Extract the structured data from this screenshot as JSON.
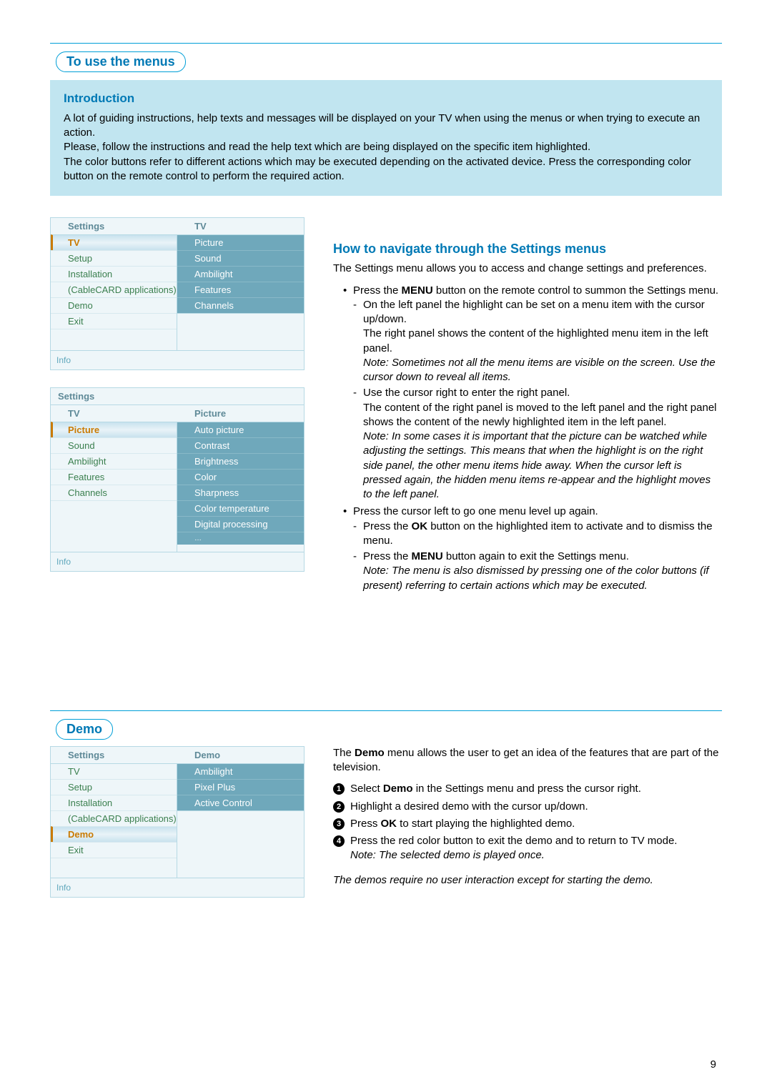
{
  "pageNumber": "9",
  "section1": {
    "title": "To use the menus",
    "intro": {
      "heading": "Introduction",
      "p1": "A lot of guiding instructions, help texts and messages will be displayed on your TV when using the menus or when trying to execute an action.",
      "p2": "Please, follow the instructions and read the help text which are being displayed on the specific item highlighted.",
      "p3": "The color buttons refer to different actions which may be executed depending on the activated device. Press the corresponding color button on the remote control to perform the required action."
    },
    "menuA": {
      "titleLeft": "Settings",
      "titleRight": "TV",
      "left": [
        "TV",
        "Setup",
        "Installation",
        "(CableCARD applications)",
        "Demo",
        "Exit"
      ],
      "right": [
        "Picture",
        "Sound",
        "Ambilight",
        "Features",
        "Channels"
      ],
      "selectedLeftIndex": 0,
      "info": "Info"
    },
    "menuB": {
      "titleLeft": "Settings",
      "headerLeft": "TV",
      "headerRight": "Picture",
      "left": [
        "Picture",
        "Sound",
        "Ambilight",
        "Features",
        "Channels"
      ],
      "right": [
        "Auto picture",
        "Contrast",
        "Brightness",
        "Color",
        "Sharpness",
        "Color temperature",
        "Digital processing",
        "…"
      ],
      "selectedLeftIndex": 0,
      "info": "Info"
    },
    "howto": {
      "heading": "How to navigate through the Settings menus",
      "intro": "The Settings menu allows you to access and change settings and preferences.",
      "b1_a": "Press the ",
      "b1_bold": "MENU",
      "b1_b": " button on the remote control to summon the Settings menu.",
      "d1_1": "On the left panel the highlight can be set on a menu item with the cursor up/down.",
      "d1_1b": "The right panel shows the content of the highlighted menu item in the left panel.",
      "d1_note": "Note: Sometimes not all the menu items are visible on the screen. Use the cursor down to reveal all items.",
      "d1_2a": "Use the cursor right to enter the right panel.",
      "d1_2b": "The content of the right panel is moved to the left panel and the right panel shows the content of the newly highlighted item in the left panel.",
      "d1_2note": "Note: In some cases it is important that the picture can be watched while adjusting the settings. This means that when the highlight is on the right side panel, the other menu items hide away. When the cursor left is pressed again, the hidden menu items re-appear and the highlight moves to the left panel.",
      "b2": "Press the cursor left to go one menu level up again.",
      "d2_1a": "Press the ",
      "d2_1bold": "OK",
      "d2_1b": " button on the highlighted item to activate and to dismiss the menu.",
      "d2_2a": "Press the ",
      "d2_2bold": "MENU",
      "d2_2b": " button again to exit the Settings menu.",
      "d2_note": "Note: The menu is also dismissed by pressing one of the color buttons (if present) referring to certain actions which may be executed."
    }
  },
  "section2": {
    "title": "Demo",
    "menu": {
      "titleLeft": "Settings",
      "titleRight": "Demo",
      "left": [
        "TV",
        "Setup",
        "Installation",
        "(CableCARD applications)",
        "Demo",
        "Exit"
      ],
      "right": [
        "Ambilight",
        "Pixel Plus",
        "Active Control"
      ],
      "selectedLeftIndex": 4,
      "info": "Info"
    },
    "body": {
      "intro_a": "The ",
      "intro_bold": "Demo",
      "intro_b": " menu allows the user to get an idea of the features that are part of the television.",
      "n1_a": "Select ",
      "n1_bold": "Demo",
      "n1_b": " in the Settings menu and press the cursor right.",
      "n2": "Highlight a desired demo with the cursor up/down.",
      "n3_a": "Press ",
      "n3_bold": "OK",
      "n3_b": " to start playing the highlighted demo.",
      "n4": "Press the red color button to exit the demo and to return to TV mode.",
      "n4_note": "Note: The selected demo is played once.",
      "closing": "The demos require no user interaction except for starting the demo."
    }
  }
}
